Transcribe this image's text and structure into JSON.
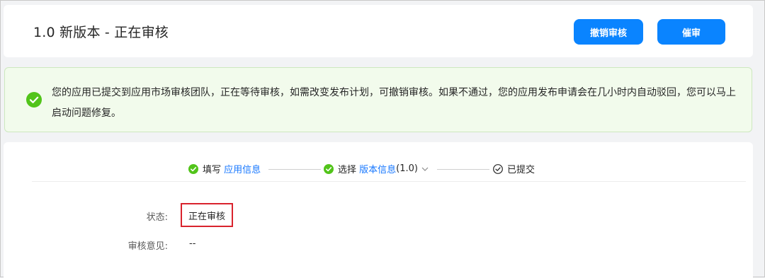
{
  "header": {
    "title": "1.0 新版本 - 正在审核",
    "withdraw_label": "撤销审核",
    "urge_label": "催审"
  },
  "notice": {
    "text": "您的应用已提交到应用市场审核团队，正在等待审核，如需改变发布计划，可撤销审核。如果不通过，您的应用发布申请会在几小时内自动驳回，您可以马上启动问题修复。",
    "icon": "check-circle-icon"
  },
  "steps": [
    {
      "prefix": "填写",
      "link": "应用信息",
      "suffix": ""
    },
    {
      "prefix": "选择",
      "link": "版本信息",
      "suffix": "(1.0)"
    },
    {
      "prefix": "已提交",
      "link": "",
      "suffix": ""
    }
  ],
  "fields": {
    "status_label": "状态:",
    "status_value": "正在审核",
    "review_label": "审核意见:",
    "review_value": "--"
  },
  "colors": {
    "primary": "#0a84ff",
    "success": "#52c41a",
    "highlight_border": "#d9232d",
    "link": "#1677ff"
  }
}
